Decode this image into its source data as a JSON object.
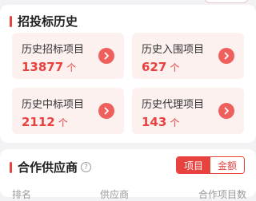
{
  "history": {
    "title": "招投标历史",
    "stats": [
      {
        "label": "历史招标项目",
        "value": "13877",
        "unit": "个"
      },
      {
        "label": "历史入围项目",
        "value": "627",
        "unit": "个"
      },
      {
        "label": "历史中标项目",
        "value": "2112",
        "unit": "个"
      },
      {
        "label": "历史代理项目",
        "value": "143",
        "unit": "个"
      }
    ]
  },
  "partners": {
    "title": "合作供应商",
    "help_icon": "?",
    "toggle": {
      "options": [
        "项目",
        "金额"
      ],
      "selected": "项目"
    },
    "columns": [
      "排名",
      "供应商",
      "合作项目数"
    ]
  },
  "colors": {
    "accent": "#e8423f",
    "stat_bg": "#fdf1f0"
  }
}
